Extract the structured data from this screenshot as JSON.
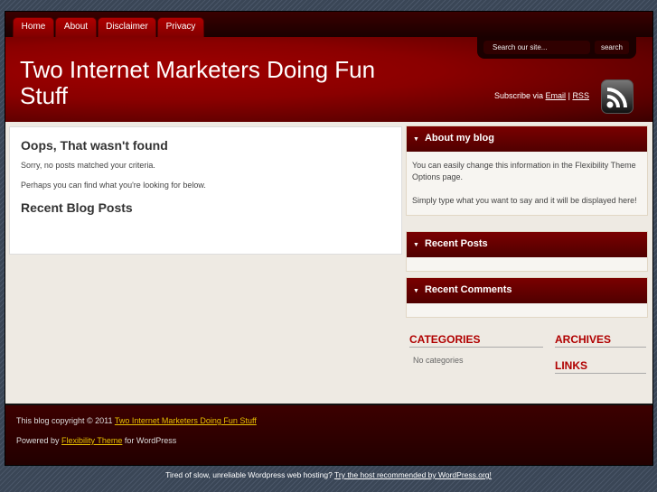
{
  "nav": [
    "Home",
    "About",
    "Disclaimer",
    "Privacy"
  ],
  "header": {
    "title": "Two Internet Marketers Doing Fun Stuff",
    "search_placeholder": "Search our site...",
    "search_button": "search",
    "subscribe_prefix": "Subscribe via",
    "email": "Email",
    "sep": "|",
    "rss": "RSS"
  },
  "main": {
    "heading": "Oops, That wasn't found",
    "p1": "Sorry, no posts matched your criteria.",
    "p2": "Perhaps you can find what you're looking for below.",
    "recent": "Recent Blog Posts"
  },
  "sidebar": {
    "about_title": "About my blog",
    "about_p1": "You can easily change this information in the Flexibility Theme Options page.",
    "about_p2": "Simply type what you want to say and it will be displayed here!",
    "recent_posts": "Recent Posts",
    "recent_comments": "Recent Comments",
    "categories": "CATEGORIES",
    "no_categories": "No categories",
    "archives": "ARCHIVES",
    "links": "LINKS"
  },
  "footer": {
    "copyright": "This blog copyright © 2011",
    "site_link": "Two Internet Marketers Doing Fun Stuff",
    "powered": "Powered by",
    "theme_link": "Flexibility Theme",
    "for_wp": "for WordPress"
  },
  "bottom": {
    "text": "Tired of slow, unreliable Wordpress web hosting?",
    "link": "Try the host recommended by WordPress.org!"
  }
}
